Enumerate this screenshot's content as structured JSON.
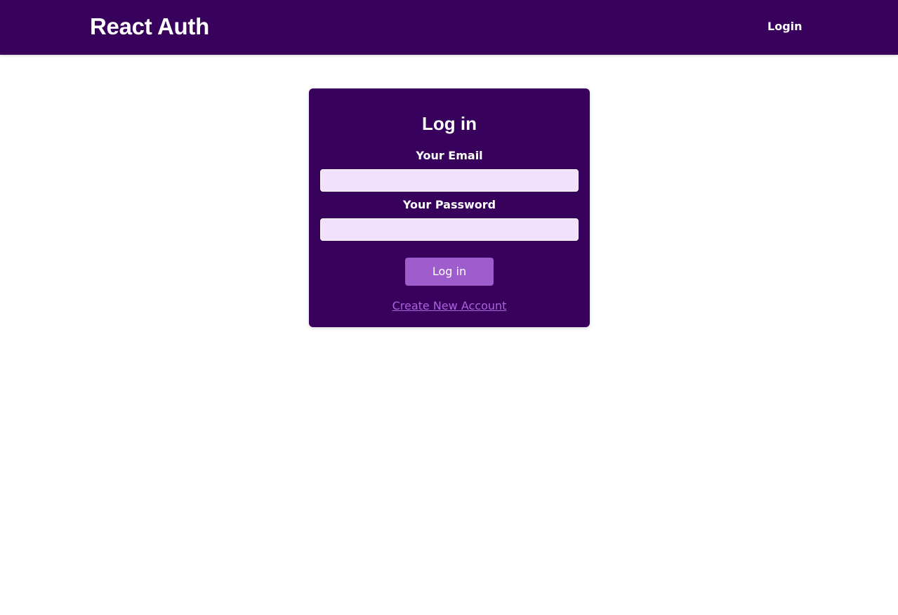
{
  "header": {
    "brand": "React Auth",
    "nav": {
      "login_label": "Login"
    }
  },
  "auth": {
    "title": "Log in",
    "email_label": "Your Email",
    "email_value": "",
    "password_label": "Your Password",
    "password_value": "",
    "submit_label": "Log in",
    "toggle_label": "Create New Account"
  },
  "colors": {
    "primary": "#38015c",
    "input_background": "#f1e1fc",
    "button": "#9f5ccc",
    "link": "#a964de"
  }
}
